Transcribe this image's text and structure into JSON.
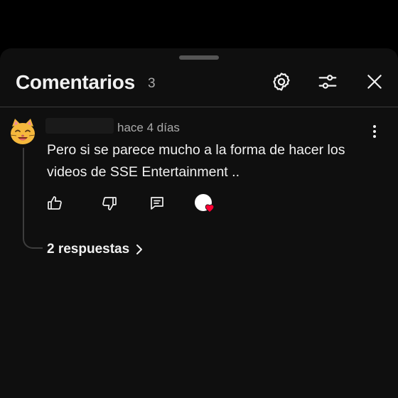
{
  "header": {
    "title": "Comentarios",
    "count": "3",
    "icons": [
      "gear-icon",
      "sliders-icon",
      "close-icon"
    ]
  },
  "comment": {
    "avatar": "cat-face-icon",
    "timestamp": "hace 4 días",
    "text": "Pero si se parece mucho a la forma de hacer los videos de SSE Entertainment ..",
    "actions": [
      "thumbs-up-icon",
      "thumbs-down-icon",
      "reply-icon",
      "creator-heart"
    ],
    "replies_label": "2 respuestas"
  },
  "colors": {
    "background": "#0f0f0f",
    "text_primary": "#f1f1f1",
    "text_secondary": "#aaaaaa",
    "heart": "#ff0033"
  }
}
